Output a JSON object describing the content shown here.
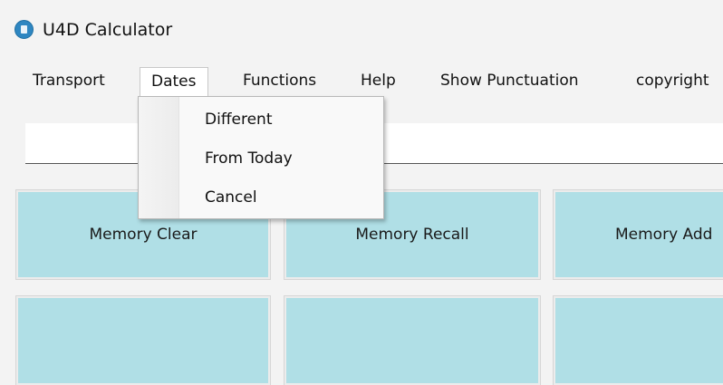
{
  "window": {
    "title": "U4D Calculator"
  },
  "menubar": {
    "items": [
      {
        "label": "Transport"
      },
      {
        "label": "Dates"
      },
      {
        "label": "Functions"
      },
      {
        "label": "Help"
      },
      {
        "label": "Show Punctuation"
      },
      {
        "label": "copyright"
      }
    ],
    "open_menu": "Dates"
  },
  "dates_menu": {
    "items": [
      {
        "label": "Different"
      },
      {
        "label": "From Today"
      },
      {
        "label": "Cancel"
      }
    ]
  },
  "display": {
    "value": ""
  },
  "keypad": {
    "row1": [
      {
        "label": "Memory Clear"
      },
      {
        "label": "Memory Recall"
      },
      {
        "label": "Memory Add"
      }
    ],
    "row2": [
      {
        "label": ""
      },
      {
        "label": ""
      },
      {
        "label": ""
      }
    ]
  },
  "colors": {
    "key_background": "#b0dfe6",
    "window_background": "#f3f3f3",
    "app_icon": "#2e86c1"
  }
}
